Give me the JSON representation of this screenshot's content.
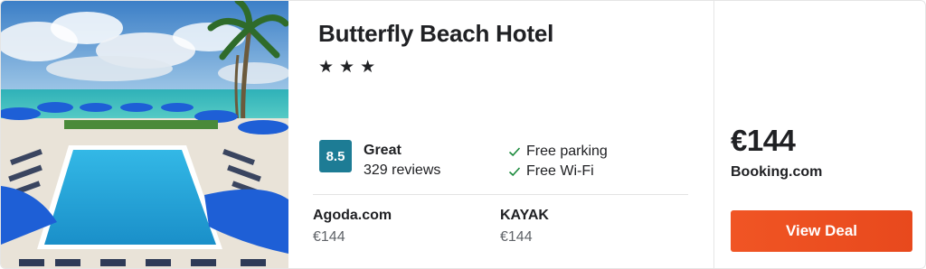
{
  "hotel": {
    "name": "Butterfly Beach Hotel",
    "stars": [
      "★",
      "★",
      "★"
    ],
    "rating_score": "8.5",
    "rating_label": "Great",
    "reviews": "329 reviews",
    "amenities": [
      "Free parking",
      "Free Wi-Fi"
    ]
  },
  "providers": [
    {
      "name": "Agoda.com",
      "price": "€144"
    },
    {
      "name": "KAYAK",
      "price": "€144"
    }
  ],
  "deal": {
    "price": "€144",
    "site": "Booking.com",
    "button_label": "View Deal"
  },
  "colors": {
    "rating_badge": "#1d7c95",
    "deal_button": "#f05524",
    "check": "#1b8a3c"
  },
  "icons": {
    "amenity_check": "check-icon",
    "star": "star-icon"
  }
}
